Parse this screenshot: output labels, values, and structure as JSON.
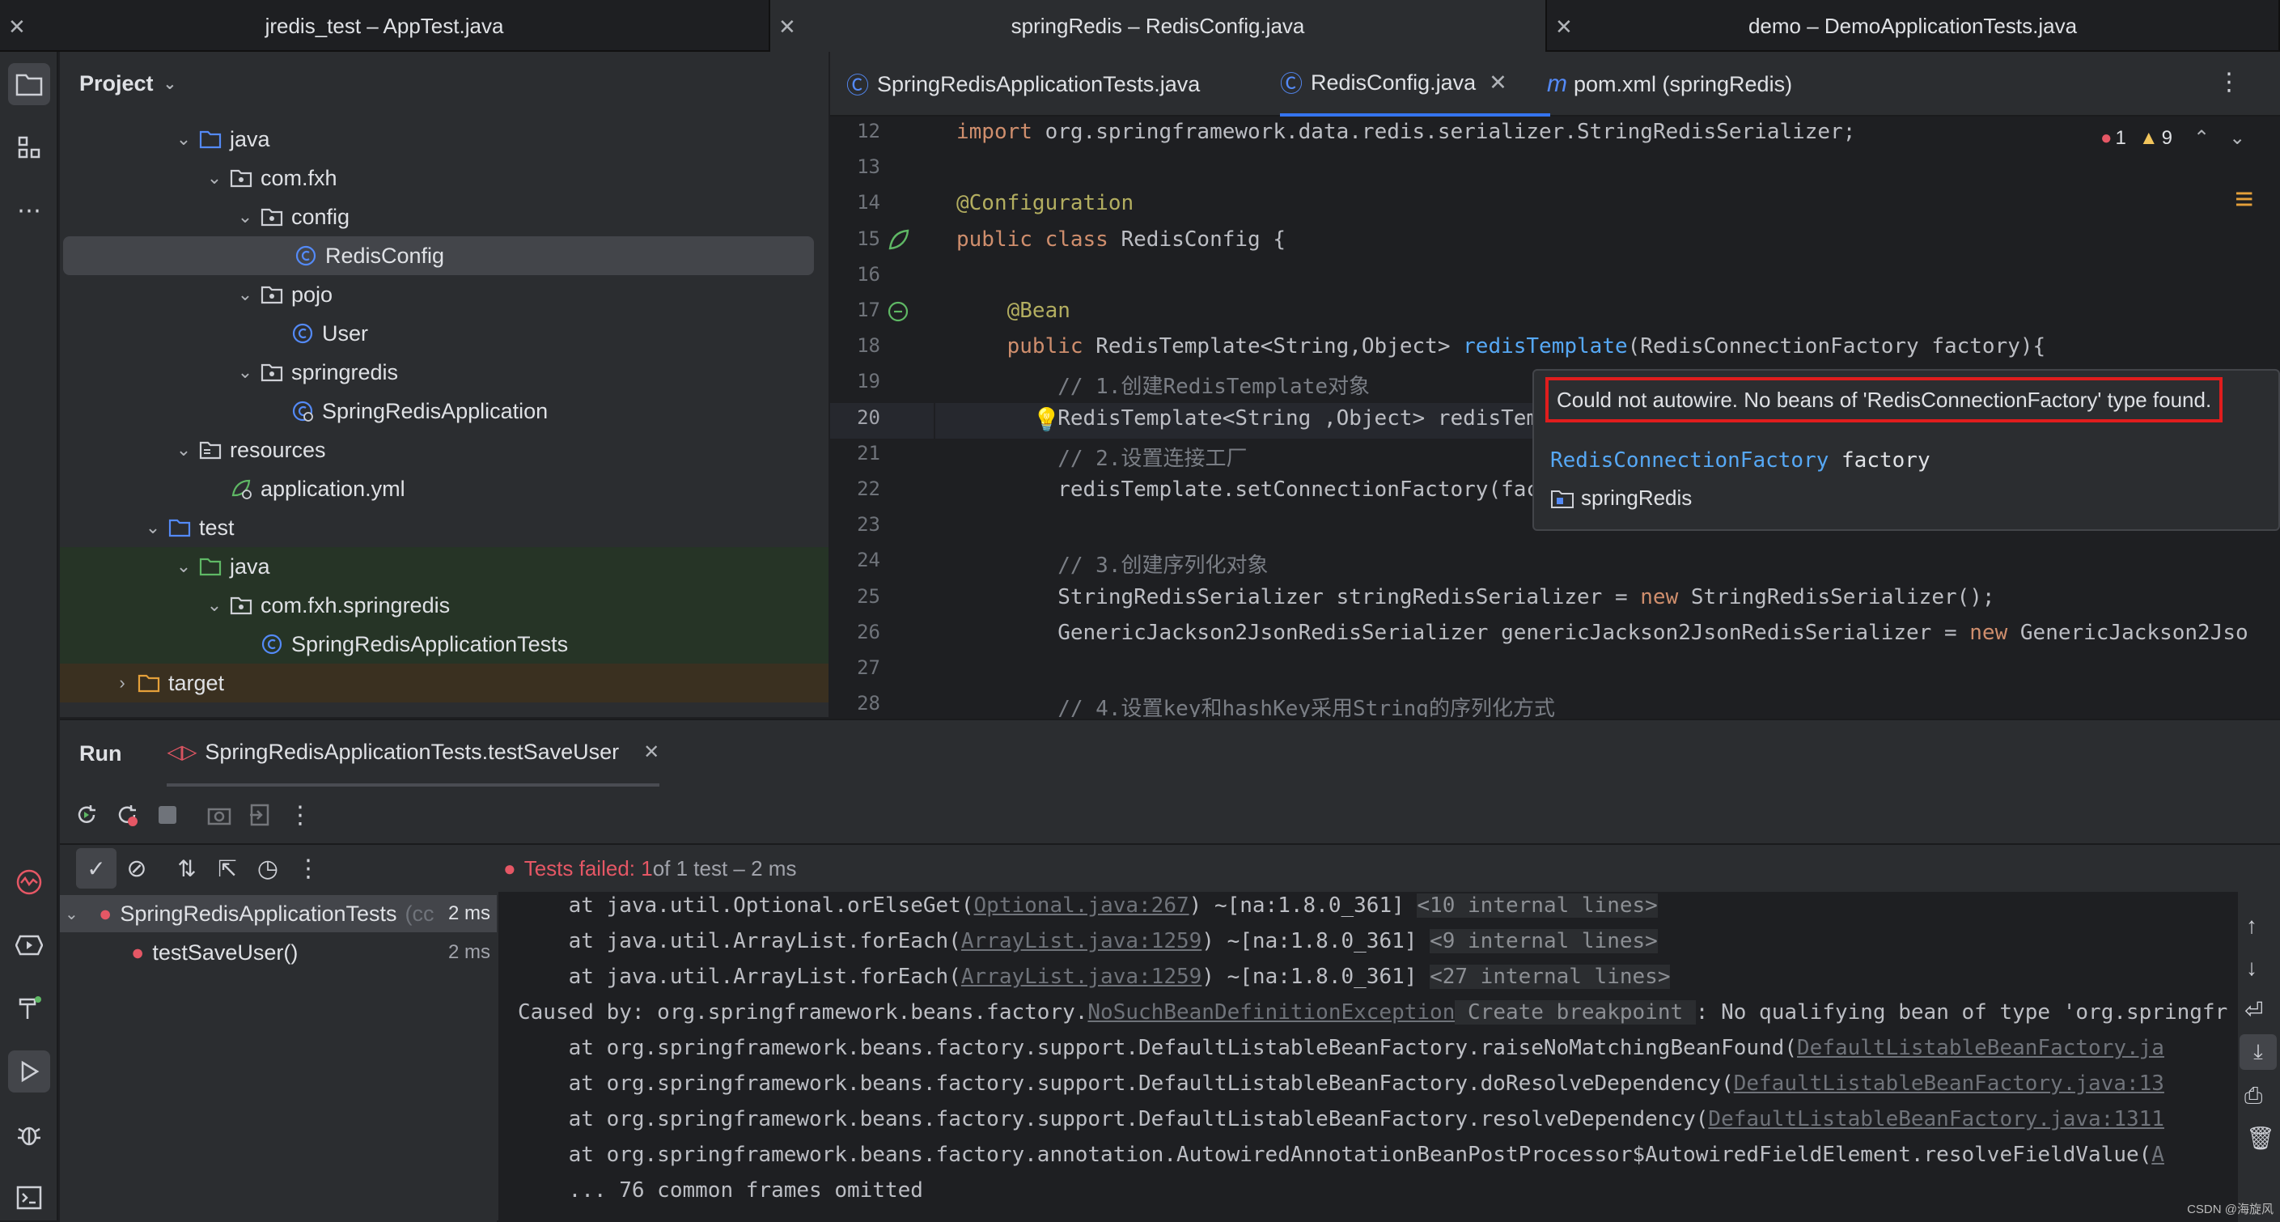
{
  "window_tabs": [
    {
      "label": "jredis_test – AppTest.java"
    },
    {
      "label": "springRedis – RedisConfig.java"
    },
    {
      "label": "demo – DemoApplicationTests.java"
    }
  ],
  "project": {
    "title": "Project",
    "tree": [
      {
        "label": "java",
        "depth": 3,
        "arrow": "v",
        "icon": "folder"
      },
      {
        "label": "com.fxh",
        "depth": 4,
        "arrow": "v",
        "icon": "package"
      },
      {
        "label": "config",
        "depth": 5,
        "arrow": "v",
        "icon": "package"
      },
      {
        "label": "RedisConfig",
        "depth": 6,
        "arrow": "",
        "icon": "class"
      },
      {
        "label": "pojo",
        "depth": 5,
        "arrow": "v",
        "icon": "package"
      },
      {
        "label": "User",
        "depth": 6,
        "arrow": "",
        "icon": "class"
      },
      {
        "label": "springredis",
        "depth": 5,
        "arrow": "v",
        "icon": "package"
      },
      {
        "label": "SpringRedisApplication",
        "depth": 6,
        "arrow": "",
        "icon": "spring-class"
      },
      {
        "label": "resources",
        "depth": 3,
        "arrow": "v",
        "icon": "res-folder"
      },
      {
        "label": "application.yml",
        "depth": 4,
        "arrow": "",
        "icon": "yml"
      },
      {
        "label": "test",
        "depth": 2,
        "arrow": "v",
        "icon": "folder"
      },
      {
        "label": "java",
        "depth": 3,
        "arrow": "v",
        "icon": "test-folder"
      },
      {
        "label": "com.fxh.springredis",
        "depth": 4,
        "arrow": "v",
        "icon": "package"
      },
      {
        "label": "SpringRedisApplicationTests",
        "depth": 5,
        "arrow": "",
        "icon": "class"
      },
      {
        "label": "target",
        "depth": 1,
        "arrow": ">",
        "icon": "target-folder"
      }
    ]
  },
  "editor": {
    "tabs": [
      {
        "label": "SpringRedisApplicationTests.java",
        "icon": "C"
      },
      {
        "label": "RedisConfig.java",
        "icon": "C"
      },
      {
        "label": "pom.xml (springRedis)",
        "icon": "m"
      }
    ],
    "errors": "1",
    "warnings": "9",
    "line_numbers": [
      "12",
      "13",
      "14",
      "15",
      "16",
      "17",
      "18",
      "19",
      "20",
      "21",
      "22",
      "23",
      "24",
      "25",
      "26",
      "27",
      "28"
    ],
    "lines": [
      [
        {
          "t": "import ",
          "c": "kw"
        },
        {
          "t": "org.springframework.data.redis.serializer.StringRedisSerializer;",
          "c": "ty"
        }
      ],
      [],
      [
        {
          "t": "@Configuration",
          "c": "an"
        }
      ],
      [
        {
          "t": "public class ",
          "c": "kw"
        },
        {
          "t": "RedisConfig {",
          "c": "ty"
        }
      ],
      [],
      [
        {
          "t": "    @Bean",
          "c": "an"
        }
      ],
      [
        {
          "t": "    public ",
          "c": "kw"
        },
        {
          "t": "RedisTemplate<String,Object> ",
          "c": "ty"
        },
        {
          "t": "redisTemplate",
          "c": "fn"
        },
        {
          "t": "(RedisConnectionFactory factory){",
          "c": "ty"
        }
      ],
      [
        {
          "t": "        // 1.创建RedisTemplate对象",
          "c": "cm"
        }
      ],
      [
        {
          "t": "        RedisTemplate<String ,Object> redisTem",
          "c": "ty"
        }
      ],
      [
        {
          "t": "        // 2.设置连接工厂",
          "c": "cm"
        }
      ],
      [
        {
          "t": "        redisTemplate.setConnectionFactory(fac",
          "c": "ty"
        }
      ],
      [],
      [
        {
          "t": "        // 3.创建序列化对象",
          "c": "cm"
        }
      ],
      [
        {
          "t": "        StringRedisSerializer stringRedisSerializer = ",
          "c": "ty"
        },
        {
          "t": "new ",
          "c": "kw"
        },
        {
          "t": "StringRedisSerializer();",
          "c": "ty"
        }
      ],
      [
        {
          "t": "        GenericJackson2JsonRedisSerializer genericJackson2JsonRedisSerializer = ",
          "c": "ty"
        },
        {
          "t": "new ",
          "c": "kw"
        },
        {
          "t": "GenericJackson2Jso",
          "c": "ty"
        }
      ],
      [],
      [
        {
          "t": "        // 4.设置key和hashKey采用String的序列化方式",
          "c": "cm"
        }
      ]
    ],
    "popup": {
      "message": "Could not autowire. No beans of 'RedisConnectionFactory' type found.",
      "type_name": "RedisConnectionFactory",
      "param": "factory",
      "module": "springRedis"
    }
  },
  "run": {
    "title": "Run",
    "config": "SpringRedisApplicationTests.testSaveUser",
    "status_fail": "Tests failed: 1",
    "status_rest": " of 1 test – 2 ms",
    "tests": [
      {
        "label": "SpringRedisApplicationTests",
        "suffix": "(cc",
        "time": "2 ms"
      },
      {
        "label": "testSaveUser()",
        "suffix": "",
        "time": "2 ms"
      }
    ],
    "console": [
      [
        {
          "t": "    at java.util.Optional.orElseGet(",
          "c": ""
        },
        {
          "t": "Optional.java:267",
          "c": "lnk"
        },
        {
          "t": ") ~[na:1.8.0_361] ",
          "c": ""
        },
        {
          "t": "<10 internal lines>",
          "c": "fold"
        }
      ],
      [
        {
          "t": "    at java.util.ArrayList.forEach(",
          "c": ""
        },
        {
          "t": "ArrayList.java:1259",
          "c": "lnk"
        },
        {
          "t": ") ~[na:1.8.0_361] ",
          "c": ""
        },
        {
          "t": "<9 internal lines>",
          "c": "fold"
        }
      ],
      [
        {
          "t": "    at java.util.ArrayList.forEach(",
          "c": ""
        },
        {
          "t": "ArrayList.java:1259",
          "c": "lnk"
        },
        {
          "t": ") ~[na:1.8.0_361] ",
          "c": ""
        },
        {
          "t": "<27 internal lines>",
          "c": "fold"
        }
      ],
      [
        {
          "t": "Caused by: org.springframework.beans.factory.",
          "c": ""
        },
        {
          "t": "NoSuchBeanDefinitionException",
          "c": "lnk"
        },
        {
          "t": " Create breakpoint ",
          "c": "fold"
        },
        {
          "t": ": No qualifying bean of type 'org.springfr",
          "c": ""
        }
      ],
      [
        {
          "t": "    at org.springframework.beans.factory.support.DefaultListableBeanFactory.raiseNoMatchingBeanFound(",
          "c": ""
        },
        {
          "t": "DefaultListableBeanFactory.ja",
          "c": "lnk"
        }
      ],
      [
        {
          "t": "    at org.springframework.beans.factory.support.DefaultListableBeanFactory.doResolveDependency(",
          "c": ""
        },
        {
          "t": "DefaultListableBeanFactory.java:13",
          "c": "lnk"
        }
      ],
      [
        {
          "t": "    at org.springframework.beans.factory.support.DefaultListableBeanFactory.resolveDependency(",
          "c": ""
        },
        {
          "t": "DefaultListableBeanFactory.java:1311",
          "c": "lnk"
        }
      ],
      [
        {
          "t": "    at org.springframework.beans.factory.annotation.AutowiredAnnotationBeanPostProcessor$AutowiredFieldElement.resolveFieldValue(",
          "c": ""
        },
        {
          "t": "A",
          "c": "lnk"
        }
      ],
      [
        {
          "t": "    ... 76 common frames omitted",
          "c": ""
        }
      ]
    ]
  },
  "watermark": "CSDN @海旋风",
  "colors": {
    "accent": "#3574f0",
    "error": "#e55765",
    "highlight_box": "#e01d1d"
  }
}
